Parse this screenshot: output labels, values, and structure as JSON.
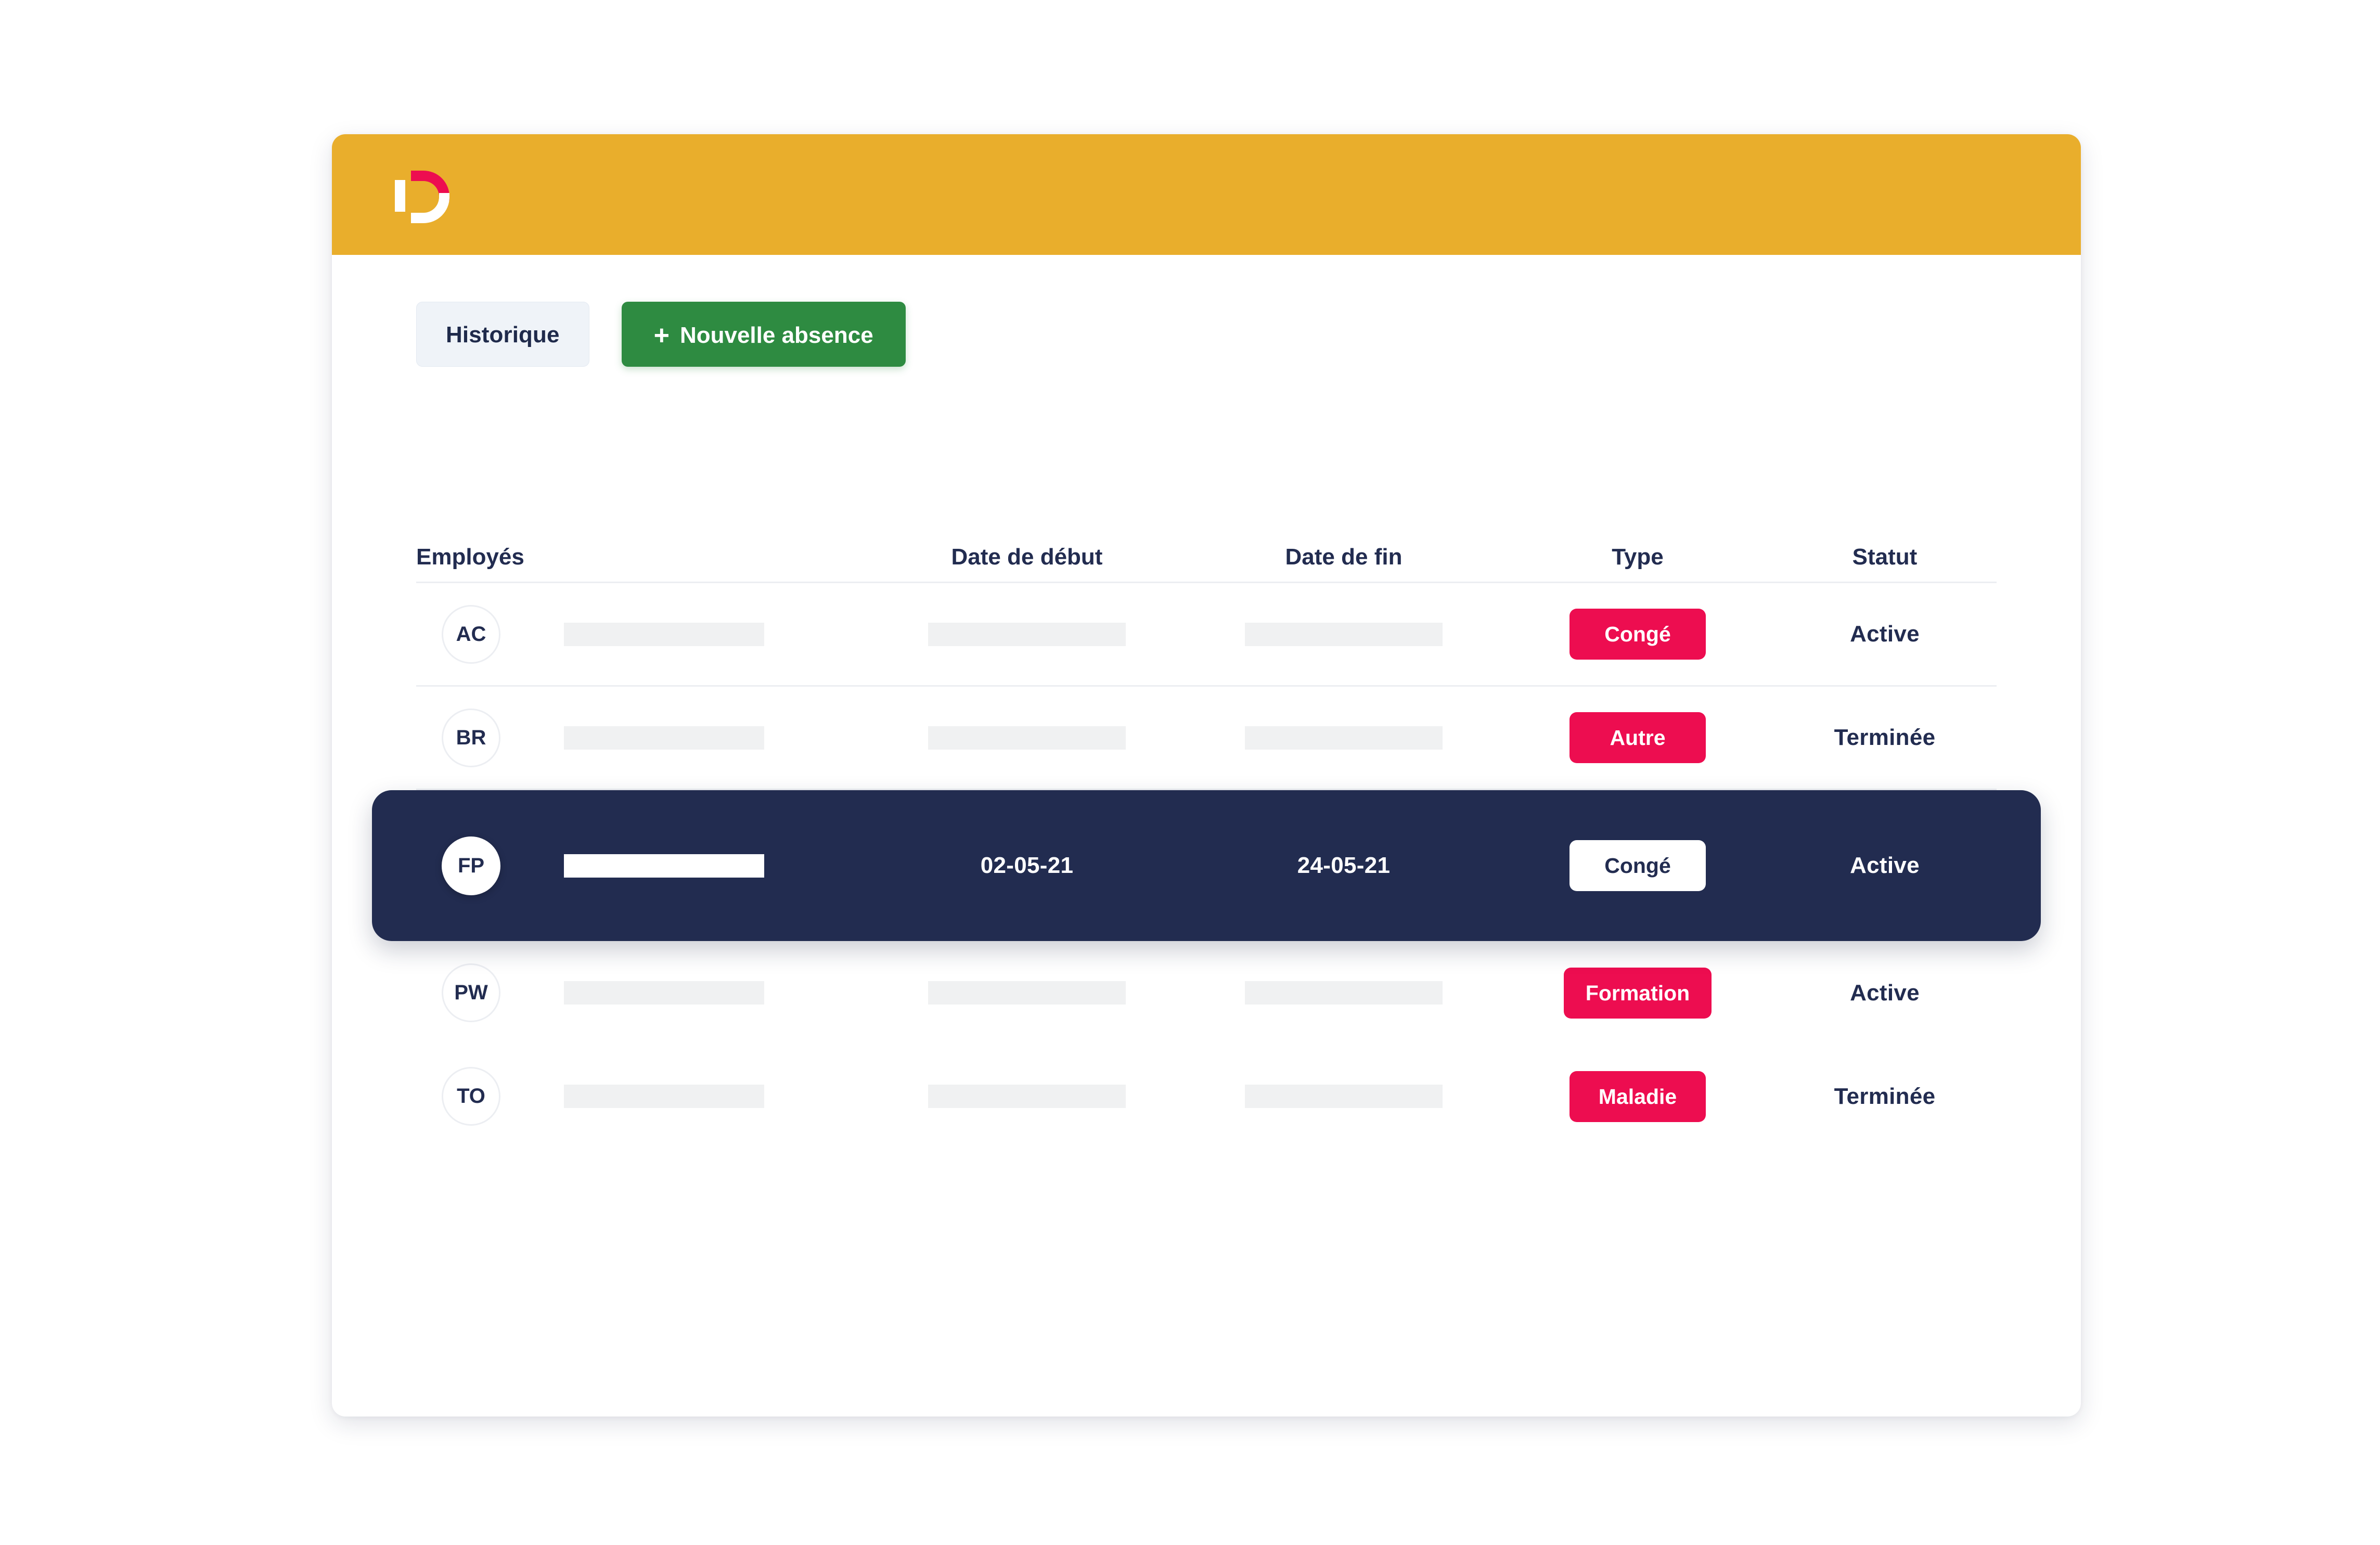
{
  "colors": {
    "header_bar": "#E9AE2C",
    "logo_accent": "#ED0D50",
    "badge": "#ED0D50",
    "primary_button": "#2E8B41",
    "selected_row": "#222C50",
    "text_dark": "#222C50",
    "secondary_button": "#EFF3F8",
    "placeholder": "#F0F1F2"
  },
  "header": {
    "logo_name": "D",
    "logo_icon": "letter-d-logo"
  },
  "toolbar": {
    "history_label": "Historique",
    "new_absence_plus": "+",
    "new_absence_label": "Nouvelle absence"
  },
  "table": {
    "columns": [
      {
        "key": "employee",
        "label": "Employés"
      },
      {
        "key": "start_date",
        "label": "Date de début"
      },
      {
        "key": "end_date",
        "label": "Date de fin"
      },
      {
        "key": "type",
        "label": "Type"
      },
      {
        "key": "status",
        "label": "Statut"
      }
    ],
    "rows": [
      {
        "initials": "AC",
        "name": "",
        "name_redacted": true,
        "start_date": "",
        "end_date": "",
        "dates_redacted": true,
        "type": "Congé",
        "status": "Active",
        "selected": false
      },
      {
        "initials": "BR",
        "name": "",
        "name_redacted": true,
        "start_date": "",
        "end_date": "",
        "dates_redacted": true,
        "type": "Autre",
        "status": "Terminée",
        "selected": false
      },
      {
        "initials": "FP",
        "name": "",
        "name_redacted": true,
        "start_date": "02-05-21",
        "end_date": "24-05-21",
        "dates_redacted": false,
        "type": "Congé",
        "status": "Active",
        "selected": true
      },
      {
        "initials": "PW",
        "name": "",
        "name_redacted": true,
        "start_date": "",
        "end_date": "",
        "dates_redacted": true,
        "type": "Formation",
        "status": "Active",
        "selected": false
      },
      {
        "initials": "TO",
        "name": "",
        "name_redacted": true,
        "start_date": "",
        "end_date": "",
        "dates_redacted": true,
        "type": "Maladie",
        "status": "Terminée",
        "selected": false
      }
    ]
  }
}
